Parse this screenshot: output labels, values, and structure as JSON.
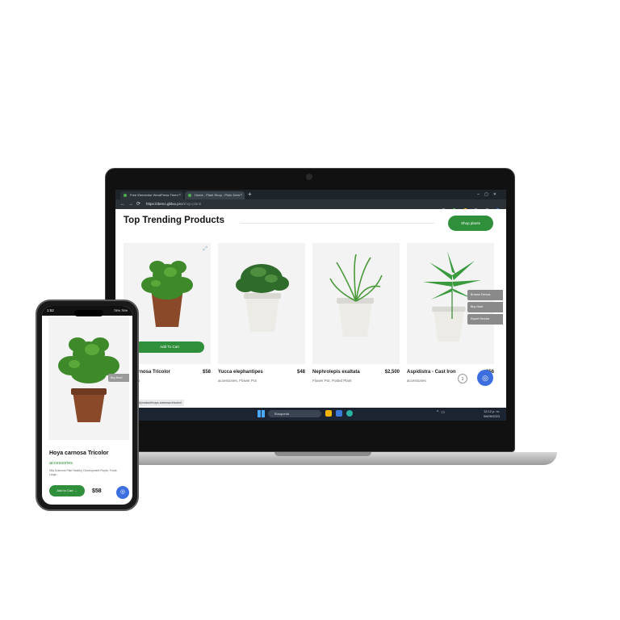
{
  "browser": {
    "tabs": [
      {
        "label": "Free Elementor WordPress Them"
      },
      {
        "label": "Home - Plant Shop - Pinto Dem"
      }
    ],
    "new_tab": "+",
    "url_host": "https://demo.gbloo.pro",
    "url_path": "/shop-plant/",
    "status_url": "...pro/shop-plant/product/hoya-carnosa-tricolor/"
  },
  "page": {
    "section_title": "Top Trending Products",
    "shop_button": "Shop plants",
    "add_to_cart": "Add To Cart",
    "products": [
      {
        "name": "Hoya carnosa Tricolor",
        "shown_name": "rnosa Tricolor",
        "price": "$58",
        "category": "s"
      },
      {
        "name": "Yucca elephantipes",
        "price": "$48",
        "category": "accessories, Flower Pot"
      },
      {
        "name": "Nephrolepis exaltata",
        "price": "$2,500",
        "category": "Flower Pot, Potted Plant"
      },
      {
        "name": "Aspidistra - Cast Iron",
        "price": "$56",
        "category": "accessories"
      }
    ],
    "side_actions": [
      "Browse Demos",
      "Buy Now!",
      "Expert Service"
    ],
    "page_number": "1"
  },
  "taskbar": {
    "search_placeholder": "Búsqueda",
    "lang": "ESP\nLAA",
    "time": "12:12 p. m.",
    "date": "06/09/2023"
  },
  "phone": {
    "time": "1:52",
    "battery": "75% 75%",
    "buy_now": "Buy Now!",
    "product_name": "Hoya carnosa Tricolor",
    "category": "accessories",
    "description": "Hila Sciences Plan Healthy, Development Purple, Fords Large...",
    "add_to_cart": "Add to Cart  →",
    "price": "$58"
  },
  "colors": {
    "brand_green": "#2f8f3a",
    "chat_blue": "#3c6ee0",
    "taskbar": "#1b2430"
  }
}
